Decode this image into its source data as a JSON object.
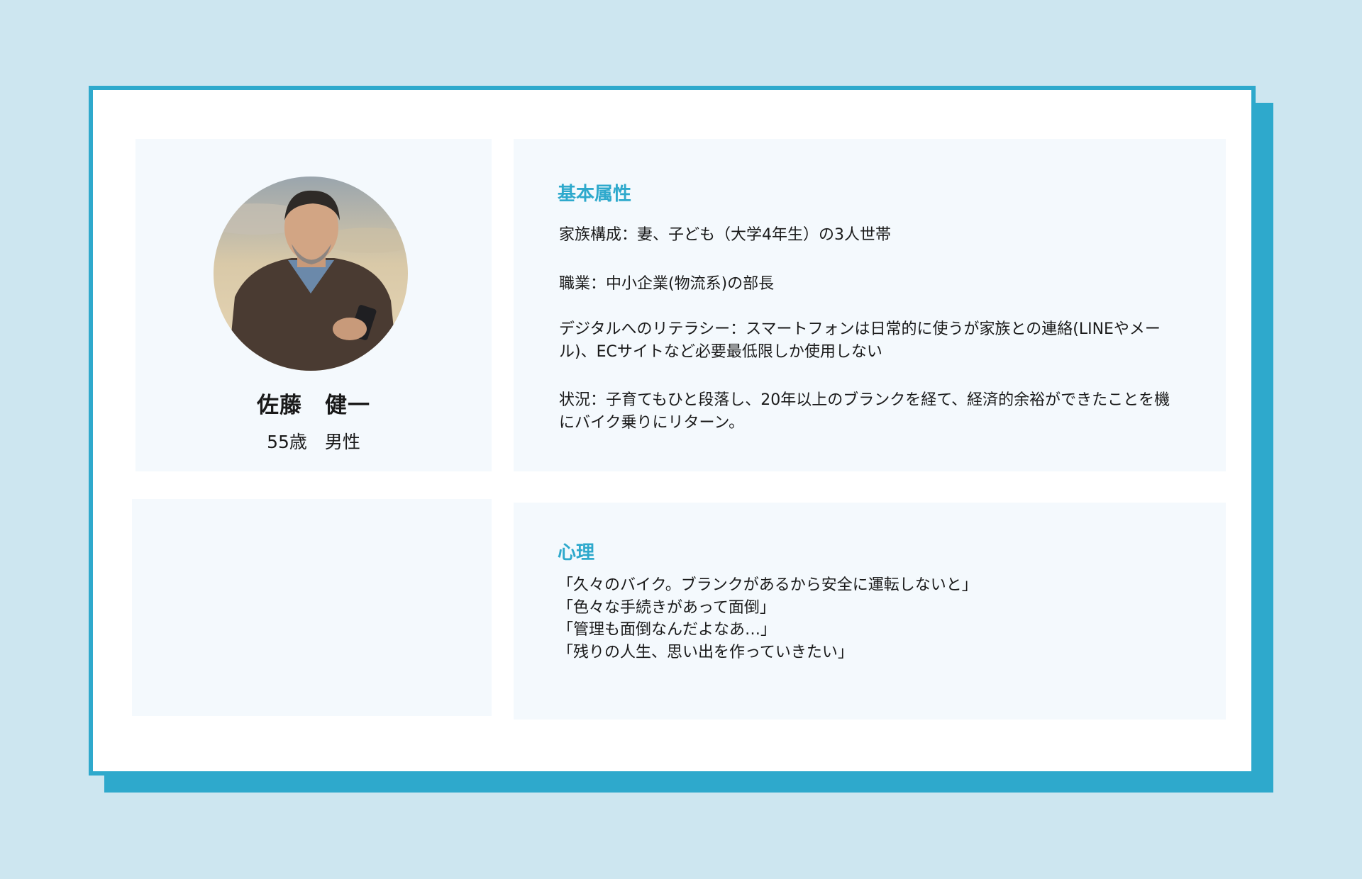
{
  "profile": {
    "name": "佐藤　健一",
    "meta": "55歳　男性"
  },
  "attributes": {
    "title": "基本属性",
    "items": [
      "家族構成：妻、子ども（大学4年生）の3人世帯",
      "職業：中小企業(物流系)の部長",
      "デジタルへのリテラシー：スマートフォンは日常的に使うが家族との連絡(LINEやメール)、ECサイトなど必要最低限しか使用しない",
      "状況：子育てもひと段落し、20年以上のブランクを経て、経済的余裕ができたことを機にバイク乗りにリターン。"
    ]
  },
  "psychology": {
    "title": "心理",
    "quotes": [
      "「久々のバイク。ブランクがあるから安全に運転しないと」",
      "「色々な手続きがあって面倒」",
      "「管理も面倒なんだよなあ…」",
      "「残りの人生、思い出を作っていきたい」"
    ]
  },
  "colors": {
    "accent": "#2ea9cc",
    "background": "#cde6f0",
    "panel": "#f4f9fd"
  },
  "icons": {
    "avatar": "person-photo"
  }
}
